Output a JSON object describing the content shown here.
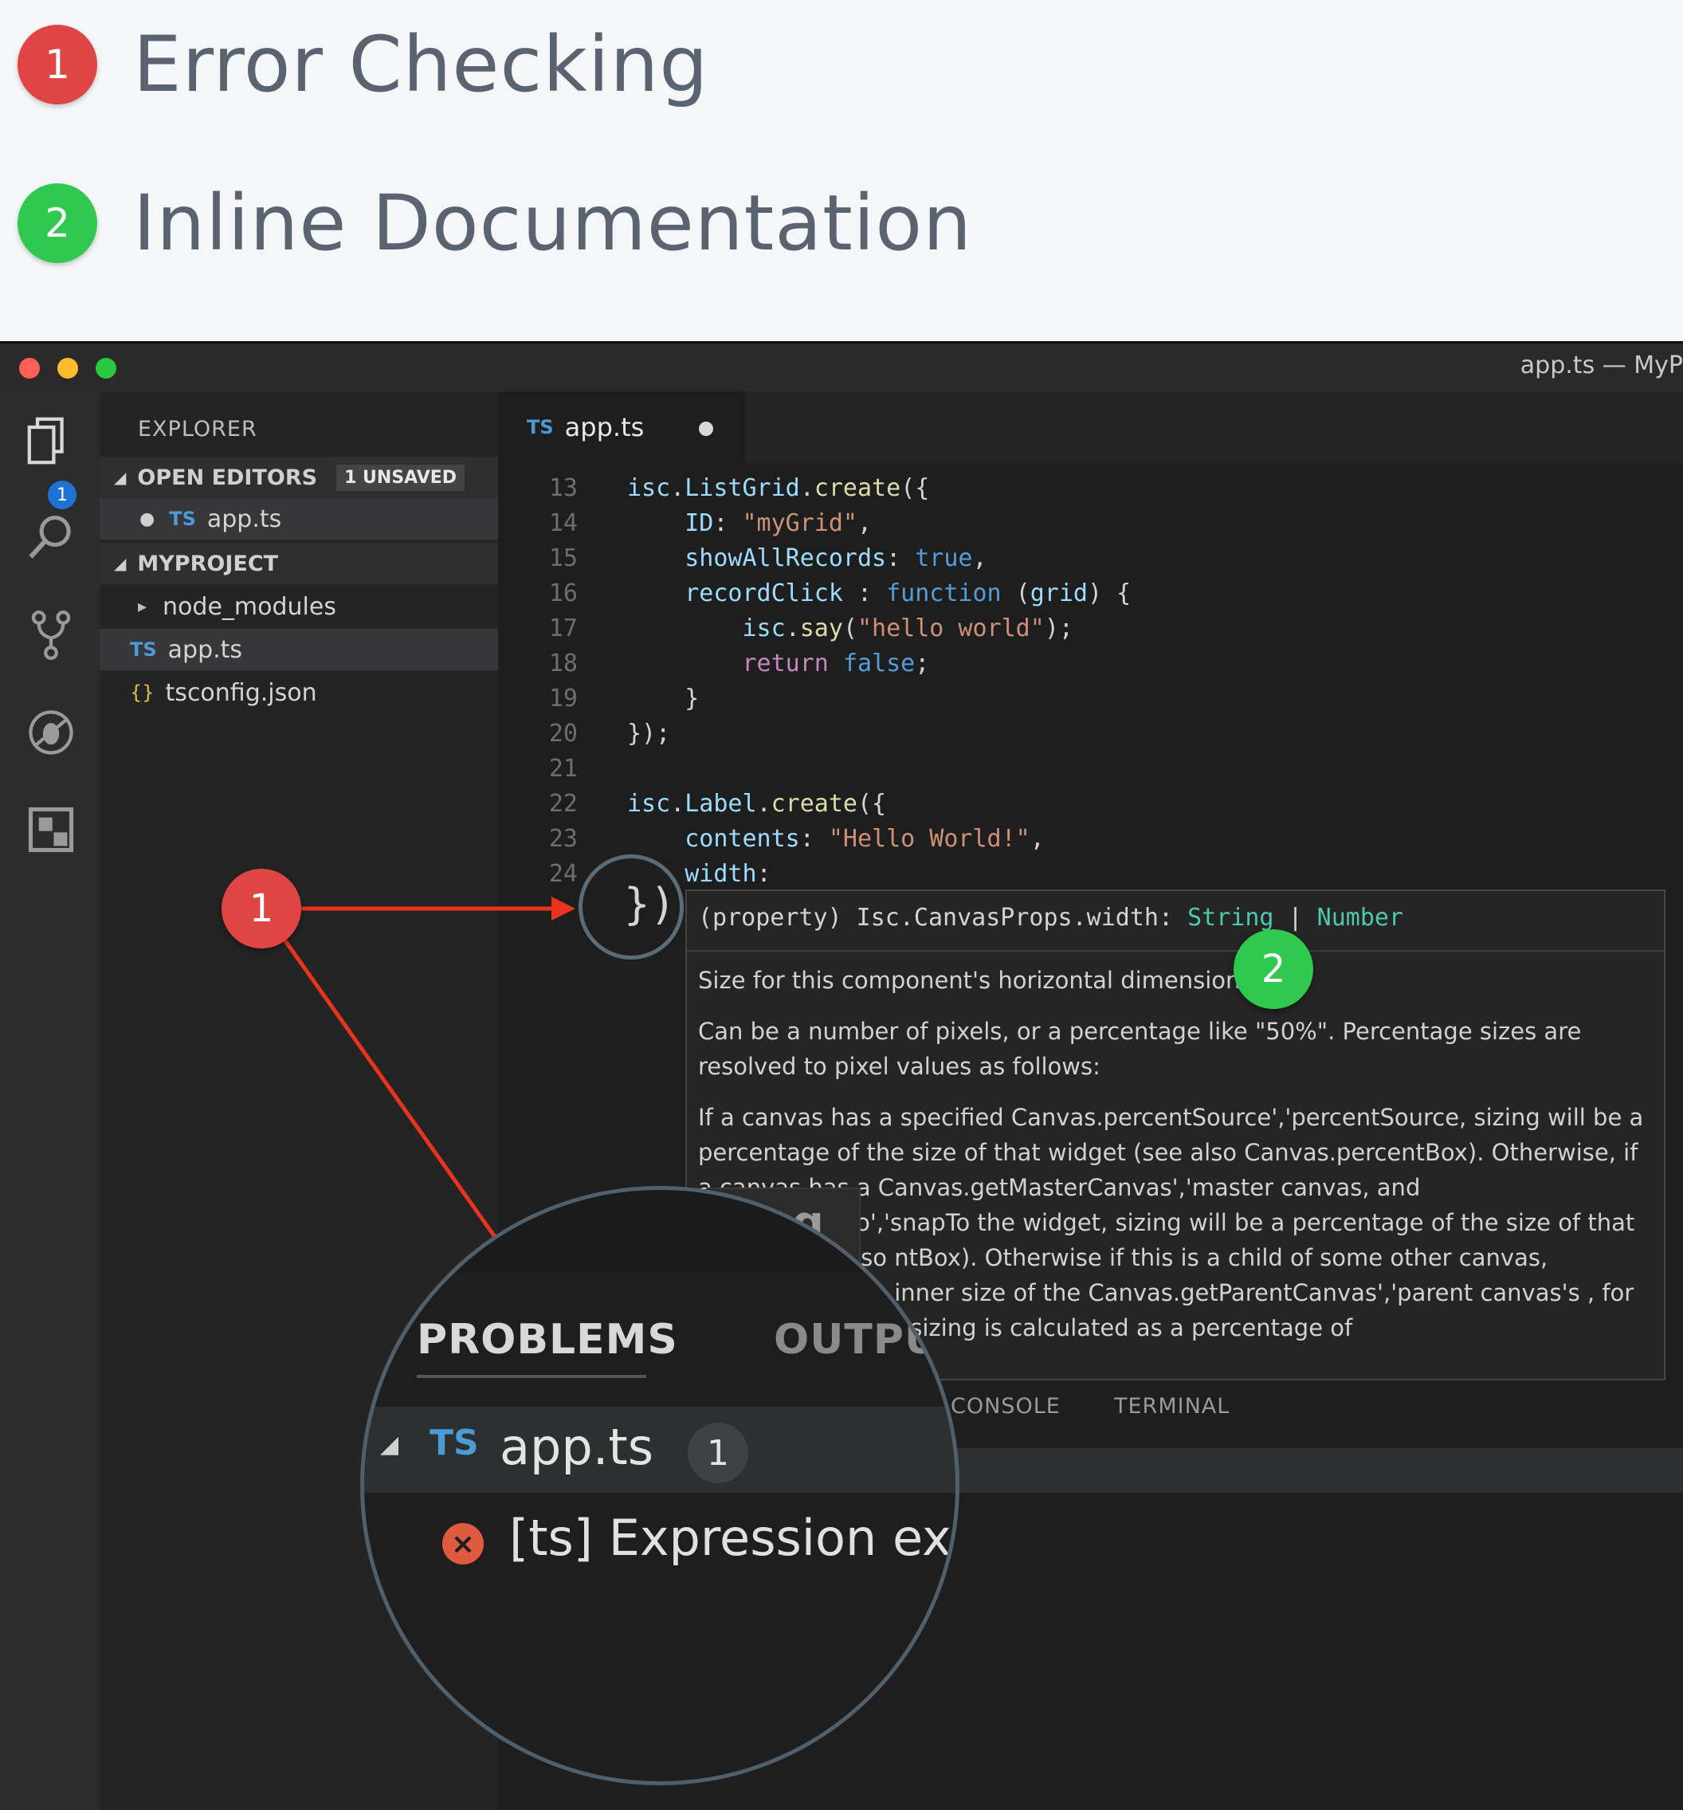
{
  "legend": [
    {
      "num": "1",
      "label": "Error Checking"
    },
    {
      "num": "2",
      "label": "Inline Documentation"
    }
  ],
  "window": {
    "title": "app.ts — MyP",
    "traffic_colors": [
      "#ff5f57",
      "#febc2e",
      "#28c840"
    ]
  },
  "activity_bar": {
    "icons": [
      "files-icon",
      "search-icon",
      "source-control-icon",
      "debug-icon",
      "extensions-icon"
    ],
    "badge": "1"
  },
  "explorer": {
    "title": "EXPLORER",
    "open_editors_label": "OPEN EDITORS",
    "unsaved_badge": "1 UNSAVED",
    "open_file_lang": "TS",
    "open_file": "app.ts",
    "project_label": "MYPROJECT",
    "items": [
      {
        "icon": "▸",
        "name": "node_modules"
      },
      {
        "icon": "TS",
        "name": "app.ts"
      },
      {
        "icon": "{}",
        "name": "tsconfig.json"
      }
    ]
  },
  "editor": {
    "tab_lang": "TS",
    "tab_label": "app.ts",
    "line_numbers": [
      "13",
      "14",
      "15",
      "16",
      "17",
      "18",
      "19",
      "20",
      "21",
      "22",
      "23",
      "24"
    ]
  },
  "hover": {
    "signature_prefix": "(property) Isc.CanvasProps.width: ",
    "type_a": "String",
    "type_sep": " | ",
    "type_b": "Number",
    "p1": "Size for this component's horizontal dimension.",
    "p2": "Can be a number of pixels, or a percentage like \"50%\". Percentage sizes are resolved to pixel values as follows:",
    "p3": "If a canvas has a specified Canvas.percentSource','percentSource, sizing will be a percentage of the size of that widget (see also Canvas.percentBox). Otherwise, if a canvas has a Canvas.getMasterCanvas','master canvas, and Canvas.snapTo','snapTo the widget, sizing will be a percentage of the size of that widget (see also ntBox). Otherwise if this is a child of some other canvas, percentages the inner size of the Canvas.getParentCanvas','parent canvas's , for top level widgets, sizing is calculated as a percentage of"
  },
  "panel": {
    "console": "CONSOLE",
    "terminal": "TERMINAL"
  },
  "magnifier": {
    "problems": "PROBLEMS",
    "output": "OUTPU",
    "file_lang": "TS",
    "file": "app.ts",
    "count": "1",
    "error_text": "[ts] Expression exp",
    "ghost_text": "pag"
  },
  "callouts": {
    "one": "1",
    "two": "2"
  },
  "colors": {
    "red": "#e04545",
    "green": "#2ec94e",
    "arrow": "#e8331f"
  }
}
